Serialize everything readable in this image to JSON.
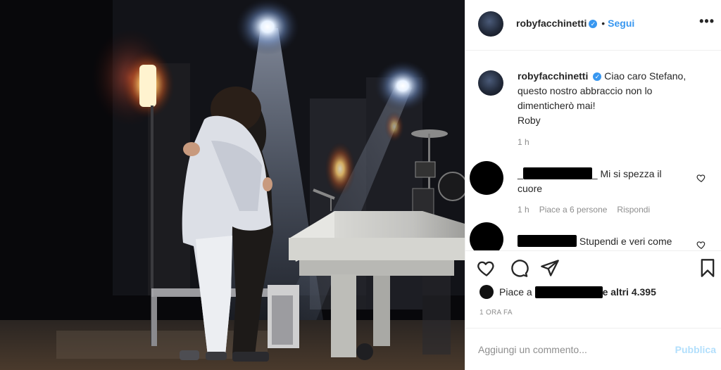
{
  "post": {
    "username": "robyfacchinetti",
    "follow_label": "Segui",
    "more_label": "•••",
    "separator": "•"
  },
  "caption": {
    "username": "robyfacchinetti",
    "text": "Ciao caro Stefano, questo nostro abbraccio non lo dimenticherò mai!",
    "signature": "Roby",
    "time": "1 h"
  },
  "comments": [
    {
      "prefix": "_",
      "suffix": "_",
      "text": "Mi si spezza il cuore",
      "time": "1 h",
      "likes": "Piace a 6 persone",
      "reply": "Rispondi"
    },
    {
      "text": "Stupendi e veri come"
    }
  ],
  "likes": {
    "prefix": "Piace a",
    "suffix": "e altri 4.395"
  },
  "timestamp": "1 ORA FA",
  "add_comment": {
    "placeholder": "Aggiungi un commento...",
    "publish_label": "Pubblica"
  },
  "icons": {
    "like": "heart-icon",
    "comment": "comment-icon",
    "share": "share-icon",
    "save": "bookmark-icon",
    "verified": "verified-badge-icon"
  },
  "colors": {
    "accent": "#3897f0",
    "publish_disabled": "#b2dffc",
    "muted": "#8e8e8e"
  }
}
